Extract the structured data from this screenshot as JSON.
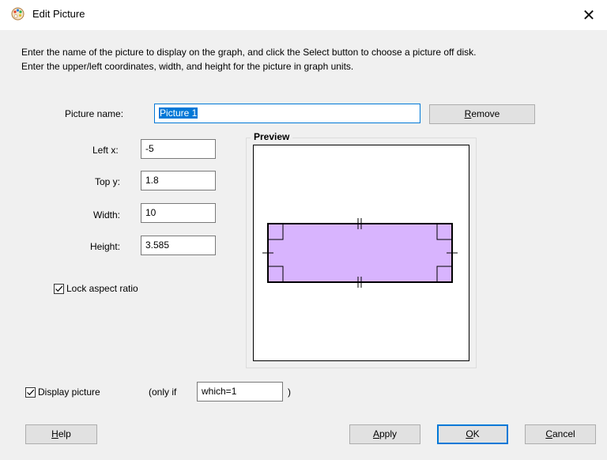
{
  "window": {
    "title": "Edit Picture",
    "close_glyph": "✕"
  },
  "instructions": {
    "line1": "Enter the name of the picture to display on the graph, and click the Select button to choose a picture off disk.",
    "line2": "Enter the upper/left coordinates, width, and height for the picture in graph units."
  },
  "picture_name": {
    "label": "Picture name:",
    "value": "Picture 1"
  },
  "remove_button": {
    "label": "Remove",
    "accel": "R",
    "rest": "emove"
  },
  "fields": {
    "left_x": {
      "label": "Left x:",
      "value": "-5"
    },
    "top_y": {
      "label": "Top y:",
      "value": "1.8"
    },
    "width": {
      "label": "Width:",
      "value": "10"
    },
    "height": {
      "label": "Height:",
      "value": "3.585"
    }
  },
  "lock_aspect": {
    "label": "Lock aspect ratio",
    "checked": true
  },
  "preview": {
    "title": "Preview",
    "picture_fill": "#d8b4fe"
  },
  "display_picture": {
    "label": "Display picture",
    "checked": true,
    "only_if_label": "(only if",
    "condition": "which=1",
    "close_paren": ")"
  },
  "buttons": {
    "help": {
      "accel": "H",
      "rest": "elp"
    },
    "apply": {
      "accel": "A",
      "rest": "pply"
    },
    "ok": {
      "accel": "O",
      "rest": "K"
    },
    "cancel": {
      "accel": "C",
      "rest": "ancel"
    }
  },
  "icons": {
    "app": "palette-icon",
    "close": "close-icon",
    "check": "checkmark-icon"
  },
  "colors": {
    "accent": "#0078d7",
    "dialog_bg": "#f0f0f0",
    "button_bg": "#e1e1e1"
  }
}
